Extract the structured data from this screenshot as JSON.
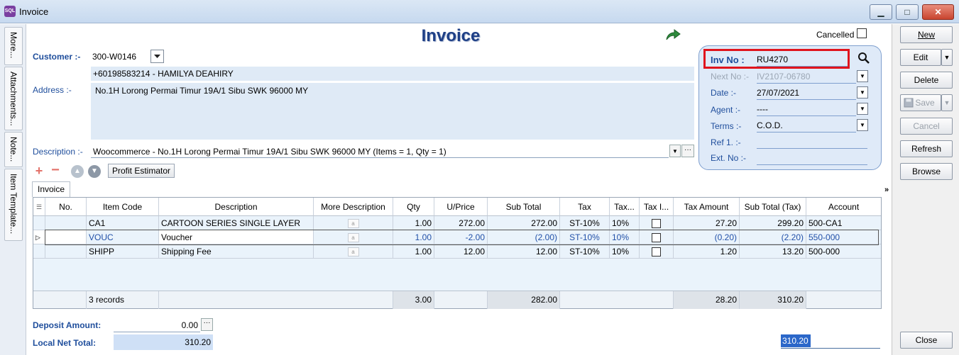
{
  "window": {
    "title": "Invoice",
    "app_icon": "SQL"
  },
  "form": {
    "title": "Invoice",
    "cancelled_label": "Cancelled"
  },
  "side_tabs": [
    "More...",
    "Attachments...",
    "Note...",
    "Item Template..."
  ],
  "customer": {
    "label": "Customer :-",
    "code": "300-W0146",
    "contact": "+60198583214 - HAMILYA DEAHIRY",
    "address_label": "Address :-",
    "address": "No.1H Lorong Permai Timur 19A/1  Sibu SWK 96000 MY",
    "description_label": "Description :-",
    "description": "Woocommerce - No.1H Lorong Permai Timur 19A/1  Sibu SWK 96000 MY (Items = 1, Qty = 1)"
  },
  "toolbar": {
    "profit_estimator": "Profit Estimator",
    "tab_invoice": "Invoice"
  },
  "panel": {
    "inv_no_label": "Inv No :",
    "inv_no": "RU4270",
    "next_no_label": "Next No :-",
    "next_no": "IV2107-06780",
    "date_label": "Date :-",
    "date": "27/07/2021",
    "agent_label": "Agent :-",
    "agent": "----",
    "terms_label": "Terms :-",
    "terms": "C.O.D.",
    "ref1_label": "Ref 1. :-",
    "ref1": "",
    "extno_label": "Ext. No :-",
    "extno": ""
  },
  "grid": {
    "headers": [
      "No.",
      "Item Code",
      "Description",
      "More Description",
      "Qty",
      "U/Price",
      "Sub Total",
      "Tax",
      "Tax...",
      "Tax I...",
      "Tax Amount",
      "Sub Total (Tax)",
      "Account"
    ],
    "rows": [
      {
        "code": "CA1",
        "desc": "CARTOON SERIES SINGLE LAYER",
        "qty": "1.00",
        "uprice": "272.00",
        "subtotal": "272.00",
        "tax": "ST-10%",
        "taxrate": "10%",
        "taxamt": "27.20",
        "subtax": "299.20",
        "account": "500-CA1"
      },
      {
        "code": "VOUC",
        "desc": "Voucher",
        "qty": "1.00",
        "uprice": "-2.00",
        "subtotal": "(2.00)",
        "tax": "ST-10%",
        "taxrate": "10%",
        "taxamt": "(0.20)",
        "subtax": "(2.20)",
        "account": "550-000"
      },
      {
        "code": "SHIPP",
        "desc": "Shipping Fee",
        "qty": "1.00",
        "uprice": "12.00",
        "subtotal": "12.00",
        "tax": "ST-10%",
        "taxrate": "10%",
        "taxamt": "1.20",
        "subtax": "13.20",
        "account": "500-000"
      }
    ],
    "footer": {
      "records": "3 records",
      "qty": "3.00",
      "subtotal": "282.00",
      "taxamt": "28.20",
      "subtax": "310.20"
    }
  },
  "totals": {
    "deposit_label": "Deposit Amount:",
    "deposit": "0.00",
    "net_label": "Local Net Total:",
    "net": "310.20",
    "grand_total": "310.20"
  },
  "actions": {
    "new": "New",
    "edit": "Edit",
    "delete": "Delete",
    "save": "Save",
    "cancel": "Cancel",
    "refresh": "Refresh",
    "browse": "Browse",
    "close": "Close"
  }
}
